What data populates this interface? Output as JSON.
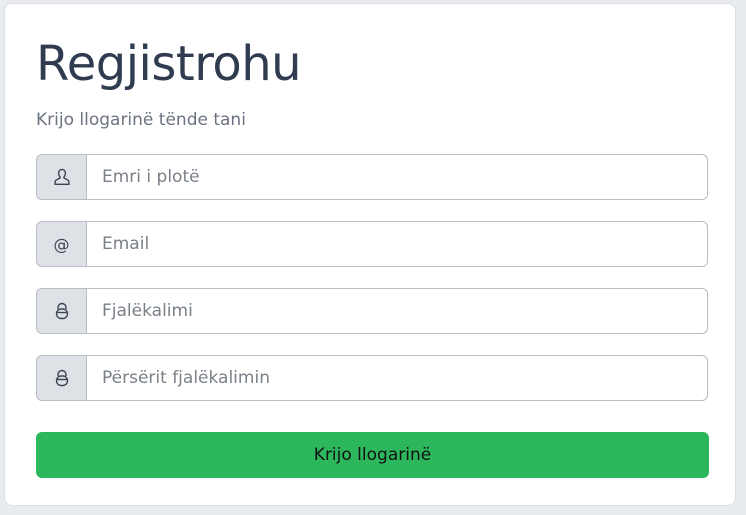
{
  "form": {
    "title": "Regjistrohu",
    "subtitle": "Krijo llogarinë tënde tani",
    "fields": [
      {
        "icon": "user-icon",
        "placeholder": "Emri i plotë",
        "value": ""
      },
      {
        "icon": "at-icon",
        "icon_glyph": "@",
        "placeholder": "Email",
        "value": ""
      },
      {
        "icon": "lock-icon",
        "placeholder": "Fjalëkalimi",
        "value": ""
      },
      {
        "icon": "lock-icon",
        "placeholder": "Përsërit fjalëkalimin",
        "value": ""
      }
    ],
    "submit_label": "Krijo llogarinë"
  },
  "colors": {
    "title": "#2f3b4f",
    "subtitle": "#6b7280",
    "addon_bg": "#dee2e6",
    "border": "#b9bec5",
    "button_bg": "#2cb75c",
    "card_bg": "#ffffff"
  }
}
